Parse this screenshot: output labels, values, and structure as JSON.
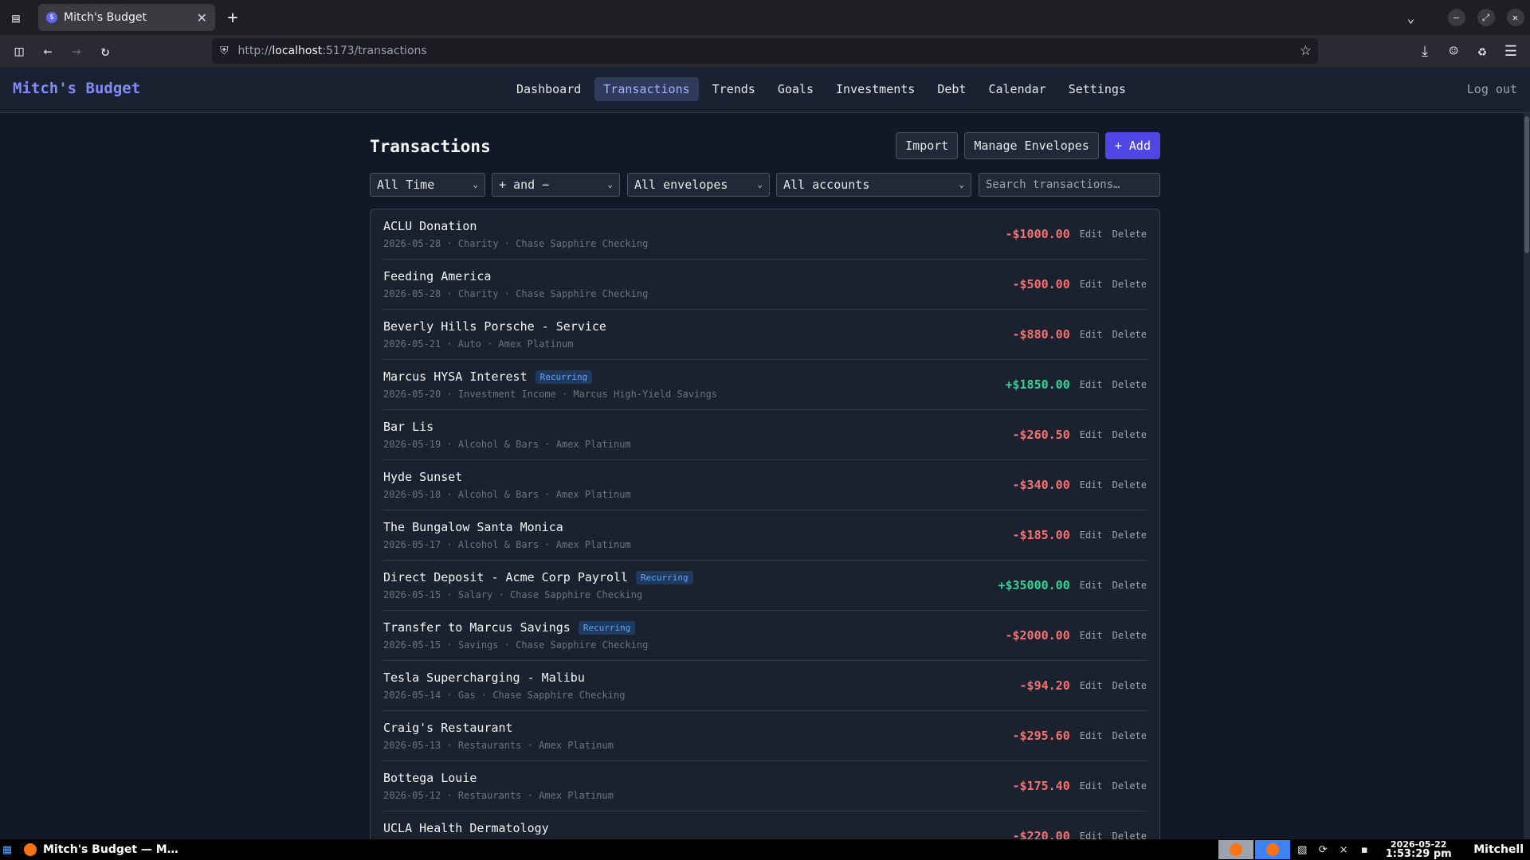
{
  "browser": {
    "tab_title": "Mitch's Budget",
    "tab_favicon": "$",
    "url_scheme": "http://",
    "url_host": "localhost",
    "url_path": ":5173/transactions"
  },
  "app": {
    "brand": "Mitch's Budget",
    "menu": [
      "Dashboard",
      "Transactions",
      "Trends",
      "Goals",
      "Investments",
      "Debt",
      "Calendar",
      "Settings"
    ],
    "active_menu": "Transactions",
    "logout": "Log out"
  },
  "page": {
    "title": "Transactions",
    "import_label": "Import",
    "manage_label": "Manage Envelopes",
    "add_label": "+ Add"
  },
  "filters": {
    "time": "All Time",
    "direction": "+ and −",
    "envelopes": "All envelopes",
    "accounts": "All accounts",
    "search_placeholder": "Search transactions…"
  },
  "transactions": [
    {
      "name": "ACLU Donation",
      "recurring": false,
      "meta": "2026-05-28 · Charity · Chase Sapphire Checking",
      "amount": "-$1000.00",
      "sign": "neg"
    },
    {
      "name": "Feeding America",
      "recurring": false,
      "meta": "2026-05-28 · Charity · Chase Sapphire Checking",
      "amount": "-$500.00",
      "sign": "neg"
    },
    {
      "name": "Beverly Hills Porsche - Service",
      "recurring": false,
      "meta": "2026-05-21 · Auto · Amex Platinum",
      "amount": "-$880.00",
      "sign": "neg"
    },
    {
      "name": "Marcus HYSA Interest",
      "recurring": true,
      "meta": "2026-05-20 · Investment Income · Marcus High-Yield Savings",
      "amount": "+$1850.00",
      "sign": "pos"
    },
    {
      "name": "Bar Lis",
      "recurring": false,
      "meta": "2026-05-19 · Alcohol & Bars · Amex Platinum",
      "amount": "-$260.50",
      "sign": "neg"
    },
    {
      "name": "Hyde Sunset",
      "recurring": false,
      "meta": "2026-05-18 · Alcohol & Bars · Amex Platinum",
      "amount": "-$340.00",
      "sign": "neg"
    },
    {
      "name": "The Bungalow Santa Monica",
      "recurring": false,
      "meta": "2026-05-17 · Alcohol & Bars · Amex Platinum",
      "amount": "-$185.00",
      "sign": "neg"
    },
    {
      "name": "Direct Deposit - Acme Corp Payroll",
      "recurring": true,
      "meta": "2026-05-15 · Salary · Chase Sapphire Checking",
      "amount": "+$35000.00",
      "sign": "pos"
    },
    {
      "name": "Transfer to Marcus Savings",
      "recurring": true,
      "meta": "2026-05-15 · Savings · Chase Sapphire Checking",
      "amount": "-$2000.00",
      "sign": "neg"
    },
    {
      "name": "Tesla Supercharging - Malibu",
      "recurring": false,
      "meta": "2026-05-14 · Gas · Chase Sapphire Checking",
      "amount": "-$94.20",
      "sign": "neg"
    },
    {
      "name": "Craig's Restaurant",
      "recurring": false,
      "meta": "2026-05-13 · Restaurants · Amex Platinum",
      "amount": "-$295.60",
      "sign": "neg"
    },
    {
      "name": "Bottega Louie",
      "recurring": false,
      "meta": "2026-05-12 · Restaurants · Amex Platinum",
      "amount": "-$175.40",
      "sign": "neg"
    },
    {
      "name": "UCLA Health Dermatology",
      "recurring": false,
      "meta": "",
      "amount": "-$220.00",
      "sign": "neg"
    }
  ],
  "labels": {
    "recurring": "Recurring",
    "edit": "Edit",
    "delete": "Delete"
  },
  "taskbar": {
    "app_title": "Mitch's Budget — M…",
    "date": "2026-05-22",
    "time": "1:53:29 pm",
    "user": "Mitchell"
  },
  "colors": {
    "accent": "#4f46e5",
    "brand": "#818cf8",
    "negative": "#f87171",
    "positive": "#34d399",
    "badge": "#60a5fa"
  },
  "icons": [
    "tab-list-icon",
    "close-icon",
    "plus-icon",
    "chevron-down-icon",
    "minimize-icon",
    "restore-icon",
    "sidebar-icon",
    "back-icon",
    "forward-icon",
    "reload-icon",
    "shield-icon",
    "star-icon",
    "download-icon",
    "account-icon",
    "extensions-icon",
    "menu-icon"
  ]
}
